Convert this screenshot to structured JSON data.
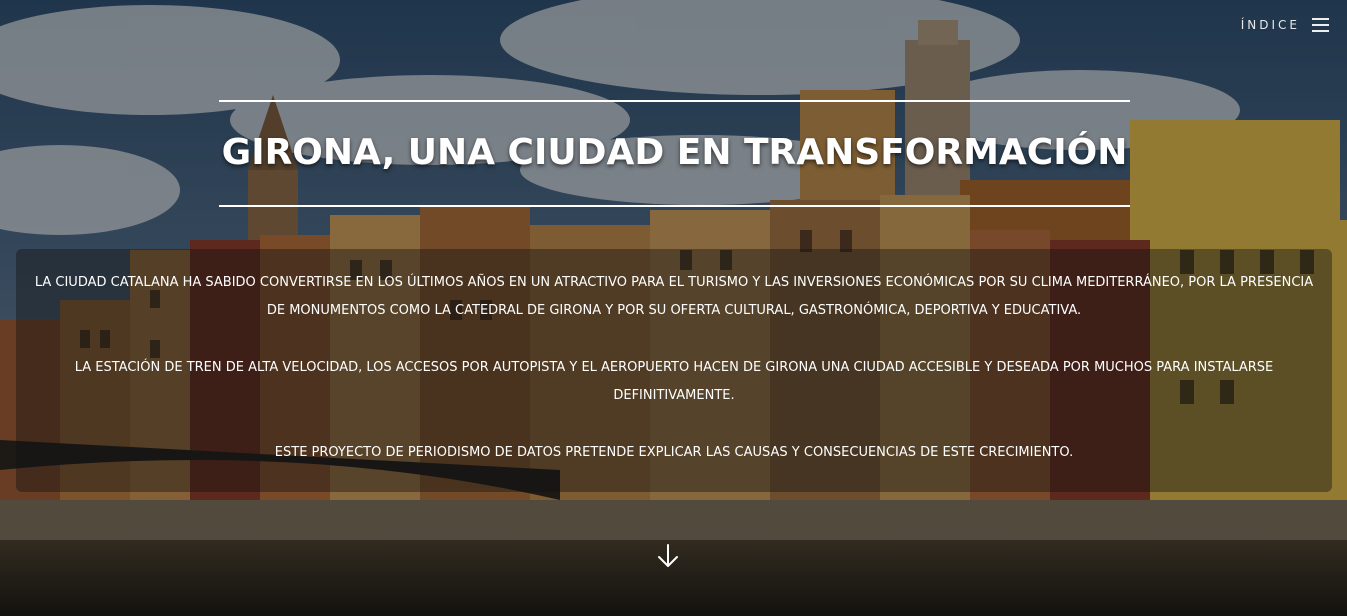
{
  "nav": {
    "menu_label": "ÍNDICE",
    "menu_icon": "hamburger-menu-icon"
  },
  "hero": {
    "title": "GIRONA, UNA CIUDAD EN TRANSFORMACIÓN",
    "paragraphs": [
      "LA CIUDAD CATALANA HA SABIDO CONVERTIRSE EN LOS ÚLTIMOS AÑOS EN UN ATRACTIVO PARA EL TURISMO Y LAS INVERSIONES ECONÓMICAS POR SU CLIMA MEDITERRÁNEO, POR LA PRESENCIA DE MONUMENTOS COMO LA CATEDRAL DE GIRONA Y POR SU OFERTA CULTURAL, GASTRONÓMICA, DEPORTIVA Y EDUCATIVA.",
      "LA ESTACIÓN DE TREN DE ALTA VELOCIDAD, LOS ACCESOS POR AUTOPISTA Y EL AEROPUERTO HACEN DE GIRONA UNA CIUDAD ACCESIBLE Y DESEADA POR MUCHOS PARA INSTALARSE DEFINITIVAMENTE.",
      "ESTE PROYECTO DE PERIODISMO DE DATOS PRETENDE EXPLICAR LAS CAUSAS Y CONSECUENCIAS DE ESTE CRECIMIENTO."
    ],
    "scroll_icon": "arrow-down-icon"
  },
  "colors": {
    "sky": "#41607f",
    "cloud": "#c9cfd6",
    "buildings_warm": "#b07a3e",
    "buildings_red": "#8a3c2c",
    "buildings_yellow": "#d7b44a",
    "river": "#2c2a22"
  }
}
